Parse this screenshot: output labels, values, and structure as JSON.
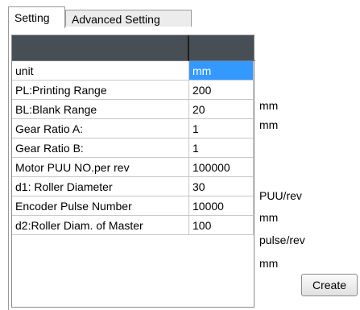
{
  "tabs": [
    {
      "label": "Setting",
      "active": true
    },
    {
      "label": "Advanced Setting",
      "active": false
    }
  ],
  "grid": {
    "header": [
      "",
      ""
    ],
    "rows": [
      {
        "label": "unit",
        "value": "mm",
        "unit": "",
        "selected": true
      },
      {
        "label": "PL:Printing Range",
        "value": "200",
        "unit": "mm"
      },
      {
        "label": "BL:Blank Range",
        "value": "20",
        "unit": "mm"
      },
      {
        "label": "Gear Ratio A:",
        "value": "1",
        "unit": ""
      },
      {
        "label": "Gear Ratio B:",
        "value": "1",
        "unit": ""
      },
      {
        "label": "Motor PUU NO.per rev",
        "value": "100000",
        "unit": "PUU/rev"
      },
      {
        "label": "d1: Roller Diameter",
        "value": "30",
        "unit": "mm"
      },
      {
        "label": "Encoder Pulse Number",
        "value": "10000",
        "unit": "pulse/rev"
      },
      {
        "label": "d2:Roller Diam. of Master",
        "value": "100",
        "unit": "mm"
      }
    ]
  },
  "actions": {
    "create_label": "Create"
  },
  "colors": {
    "header_bg": "#474e55",
    "selection": "#3399ff"
  }
}
